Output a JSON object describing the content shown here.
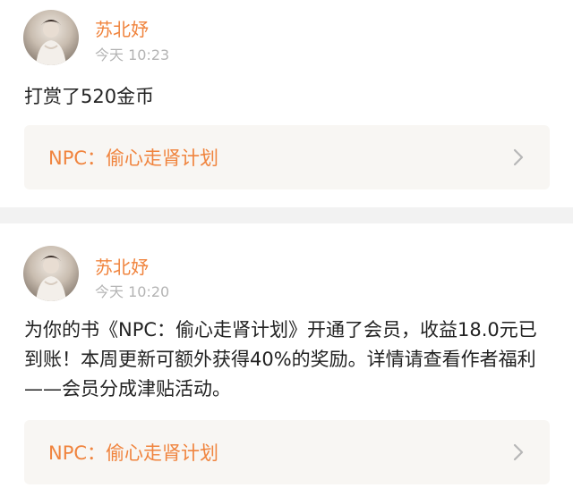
{
  "feed": {
    "items": [
      {
        "username": "苏北妤",
        "time": "今天 10:23",
        "message": "打赏了520金币",
        "book_link": "NPC：偷心走肾计划"
      },
      {
        "username": "苏北妤",
        "time": "今天 10:20",
        "message": "为你的书《NPC：偷心走肾计划》开通了会员，收益18.0元已到账！本周更新可额外获得40%的奖励。详情请查看作者福利——会员分成津贴活动。",
        "book_link": "NPC：偷心走肾计划"
      }
    ]
  },
  "icons": {
    "avatar": "user-avatar",
    "chevron": "chevron-right-icon"
  },
  "colors": {
    "accent": "#f0843e",
    "timestamp": "#b4b4b4",
    "link_bg": "#f8f6f3",
    "divider": "#f2f2f2"
  }
}
